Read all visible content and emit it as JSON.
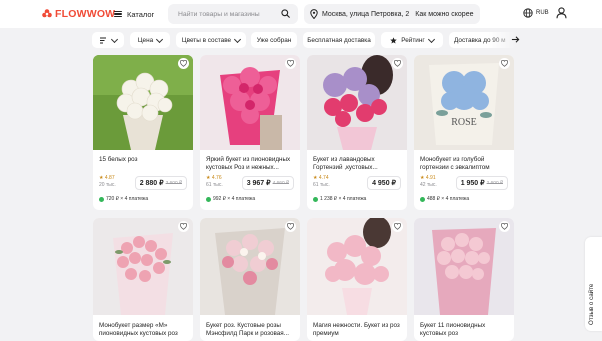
{
  "header": {
    "logo_text": "FLOWWOW",
    "catalog_label": "Каталог",
    "search_placeholder": "Найти товары и магазины",
    "address": "Москва, улица Петровка, 2",
    "delivery_time": "Как можно скорее",
    "currency": "RUB"
  },
  "filters": [
    {
      "label": ""
    },
    {
      "label": "Цена"
    },
    {
      "label": "Цветы в составе"
    },
    {
      "label": "Уже собран"
    },
    {
      "label": "Бесплатная доставка"
    },
    {
      "label": "Рейтинг"
    },
    {
      "label": "Доставка до 90 м"
    }
  ],
  "products": [
    {
      "name": "15 белых роз",
      "rating": "★ 4.87",
      "reviews": "20 тыс.",
      "price": "2 880 ₽",
      "old_price": "3 600 ₽",
      "installment": "720 ₽ × 4 платежа"
    },
    {
      "name": "Яркий букет из пионовидных кустовых Роз и нежных...",
      "rating": "★ 4.76",
      "reviews": "61 тыс.",
      "price": "3 967 ₽",
      "old_price": "4 660 ₽",
      "installment": "992 ₽ × 4 платежа"
    },
    {
      "name": "Букет из лавандовых Гортензий ,кустовых...",
      "rating": "★ 4.74",
      "reviews": "61 тыс.",
      "price": "4 950 ₽",
      "old_price": "",
      "installment": "1 238 ₽ × 4 платежа"
    },
    {
      "name": "Монобукет из голубой гортензии с эвкалиптом",
      "rating": "★ 4.91",
      "reviews": "42 тыс.",
      "price": "1 950 ₽",
      "old_price": "2 600 ₽",
      "installment": "488 ₽ × 4 платежа"
    },
    {
      "name": "Монобукет размер «М» пионовидных кустовых роз",
      "rating": "",
      "reviews": "",
      "price": "",
      "old_price": "",
      "installment": ""
    },
    {
      "name": "Букет роз. Кустовые розы Мэнсфилд Парк и розовая...",
      "rating": "",
      "reviews": "",
      "price": "",
      "old_price": "",
      "installment": ""
    },
    {
      "name": "Магия нежности. Букет из роз премиум",
      "rating": "",
      "reviews": "",
      "price": "",
      "old_price": "",
      "installment": ""
    },
    {
      "name": "Букет 11 пионовидных кустовых роз",
      "rating": "",
      "reviews": "",
      "price": "",
      "old_price": "",
      "installment": ""
    }
  ],
  "feedback_label": "Отзыв о сайте",
  "colors": {
    "brand": "#f04b37",
    "rating": "#c98a1a",
    "installment_dot": "#34b75a"
  }
}
